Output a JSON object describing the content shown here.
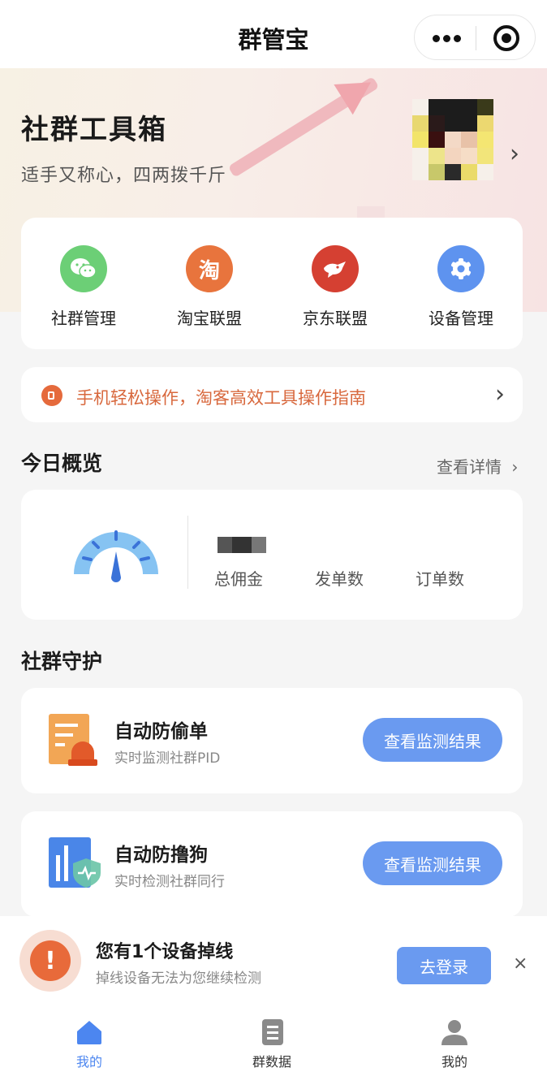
{
  "topbar": {
    "title": "群管宝"
  },
  "hero": {
    "title": "社群工具箱",
    "subtitle": "适手又称心，四两拨千斤"
  },
  "tools": [
    {
      "label": "社群管理",
      "icon": "wechat-icon",
      "color": "#6ccf76"
    },
    {
      "label": "淘宝联盟",
      "icon": "taobao-icon",
      "glyph": "淘",
      "color": "#e8743d"
    },
    {
      "label": "京东联盟",
      "icon": "jd-dog-icon",
      "color": "#d54032"
    },
    {
      "label": "设备管理",
      "icon": "gear-icon",
      "color": "#5e93ef"
    }
  ],
  "guide": {
    "text": "手机轻松操作，淘客高效工具操作指南"
  },
  "overview": {
    "title": "今日概览",
    "link": "查看详情",
    "labels": {
      "commission": "总佣金",
      "sends": "发单数",
      "orders": "订单数"
    }
  },
  "protection": {
    "title": "社群守护",
    "items": [
      {
        "title": "自动防偷单",
        "subtitle": "实时监测社群PID",
        "button": "查看监测结果"
      },
      {
        "title": "自动防撸狗",
        "subtitle": "实时检测社群同行",
        "button": "查看监测结果"
      }
    ]
  },
  "toast": {
    "title": "您有1个设备掉线",
    "subtitle": "掉线设备无法为您继续检测",
    "button": "去登录",
    "close": "×"
  },
  "tabbar": [
    {
      "label": "我的",
      "icon": "home-icon",
      "active": true
    },
    {
      "label": "群数据",
      "icon": "document-icon",
      "active": false
    },
    {
      "label": "我的",
      "icon": "user-icon",
      "active": false
    }
  ],
  "colors": {
    "accent": "#6a9af0",
    "warning": "#e86a3a"
  }
}
